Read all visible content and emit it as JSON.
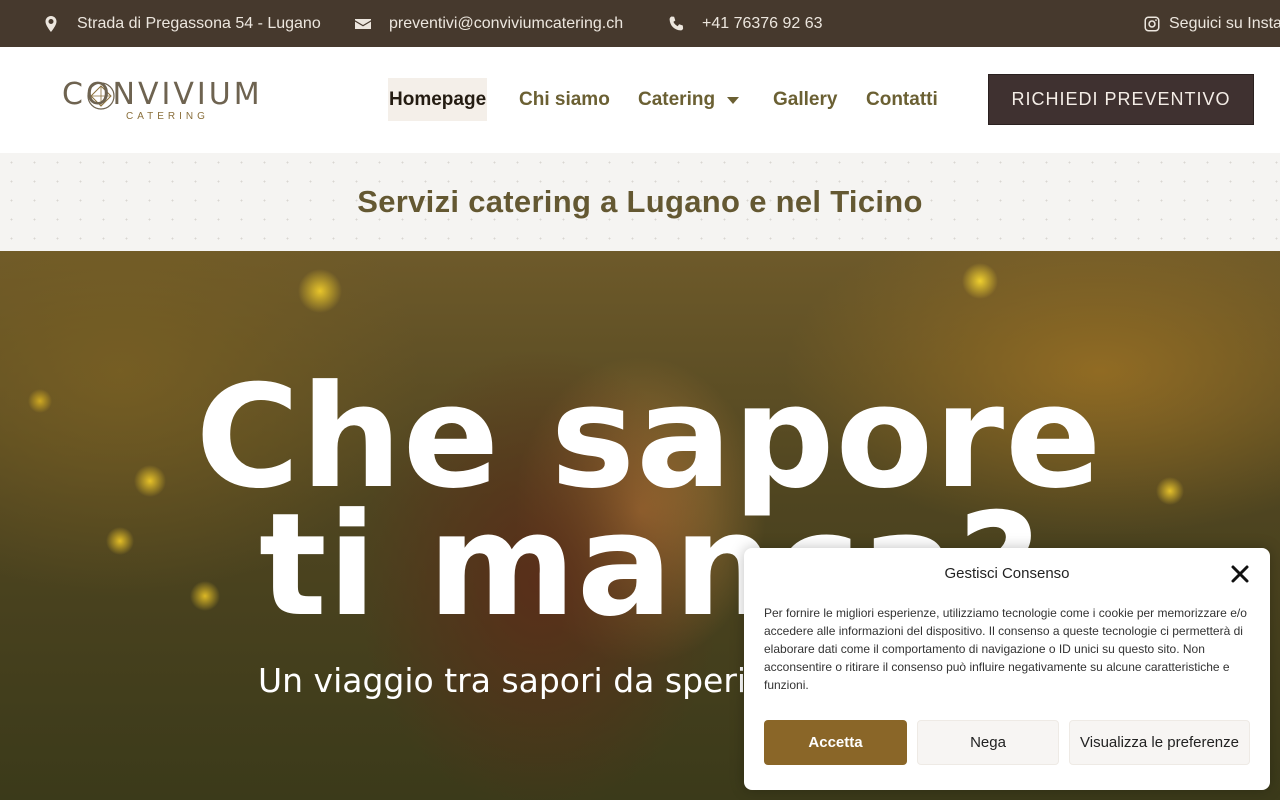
{
  "topbar": {
    "address": "Strada di Pregassona 54 - Lugano",
    "email": "preventivi@conviviumcatering.ch",
    "phone": "+41 76376 92 63",
    "social": "Seguici su Insta"
  },
  "logo": {
    "name": "CONVIVIUM",
    "tagline": "CATERING"
  },
  "nav": {
    "items": [
      {
        "label": "Homepage"
      },
      {
        "label": "Chi siamo"
      },
      {
        "label": "Catering"
      },
      {
        "label": "Gallery"
      },
      {
        "label": "Contatti"
      }
    ],
    "active_index": 0,
    "cta_label": "RICHIEDI PREVENTIVO"
  },
  "banner": {
    "title": "Servizi catering a Lugano e nel Ticino"
  },
  "hero": {
    "line1": "Che sapore",
    "line2": "ti manca?",
    "subtitle": "Un viaggio tra sapori da sperimentare"
  },
  "consent": {
    "title": "Gestisci Consenso",
    "text": "Per fornire le migliori esperienze, utilizziamo tecnologie come i cookie per memorizzare e/o accedere alle informazioni del dispositivo. Il consenso a queste tecnologie ci permetterà di elaborare dati come il comportamento di navigazione o ID unici su questo sito. Non acconsentire o ritirare il consenso può influire negativamente su alcune caratteristiche e funzioni.",
    "accept_label": "Accetta",
    "deny_label": "Nega",
    "prefs_label": "Visualizza le preferenze"
  },
  "colors": {
    "topbar_bg": "#46392d",
    "nav_text": "#6b6033",
    "cta_bg": "#3f3130",
    "accept_bg": "#8a6628"
  },
  "icons": [
    "map-pin-icon",
    "envelope-icon",
    "phone-icon",
    "instagram-icon",
    "chevron-down-icon",
    "close-icon",
    "diamond-logo-icon"
  ]
}
